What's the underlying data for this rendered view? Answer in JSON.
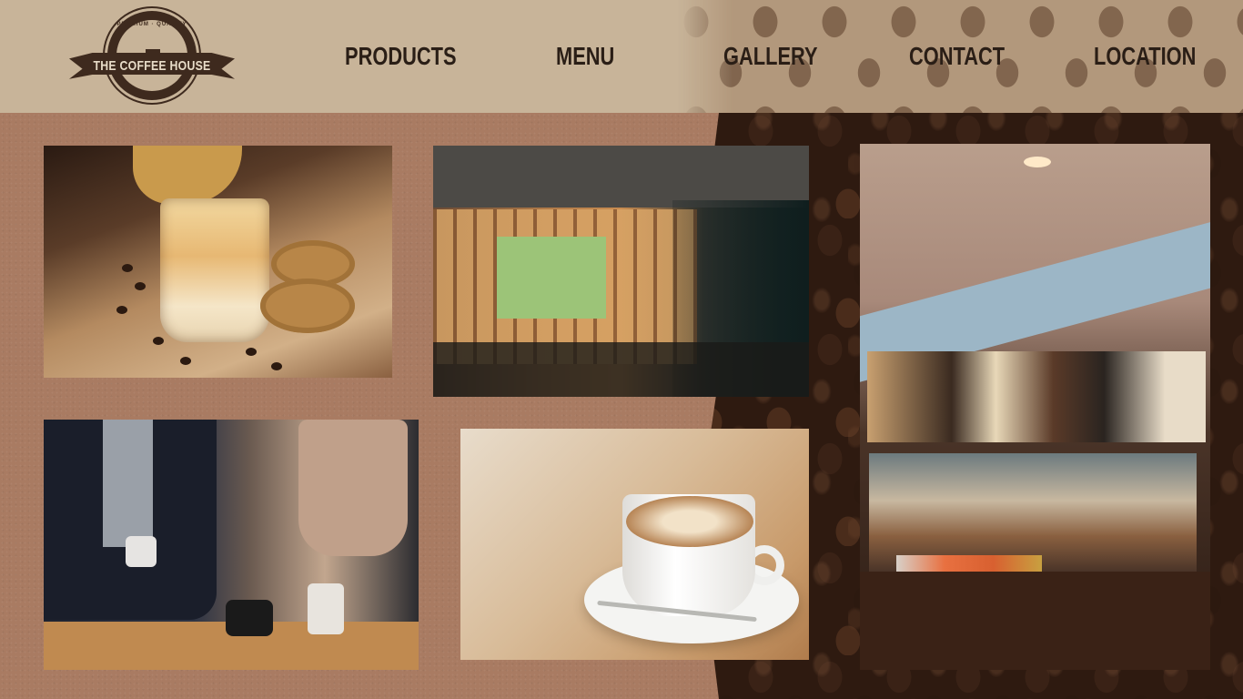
{
  "logo": {
    "badge_text": "PREMIUM · QUALITY",
    "ribbon_text": "THE COFFEE HOUSE"
  },
  "nav": {
    "items": [
      {
        "label": "PRODUCTS"
      },
      {
        "label": "MENU"
      },
      {
        "label": "GALLERY"
      },
      {
        "label": "CONTACT"
      },
      {
        "label": "LOCATION"
      }
    ]
  },
  "gallery": {
    "photos": [
      {
        "subject": "affogato-with-cookies"
      },
      {
        "subject": "cafe-interior"
      },
      {
        "subject": "coffee-shop-counter"
      },
      {
        "subject": "friends-drinking-coffee"
      },
      {
        "subject": "latte-cup-on-saucer"
      }
    ]
  },
  "colors": {
    "header_bg": "#c8b499",
    "page_bg": "#a97b62",
    "nav_text": "#2a1e16",
    "logo_dark": "#3e2a1e",
    "beans": "#2e1a10"
  }
}
